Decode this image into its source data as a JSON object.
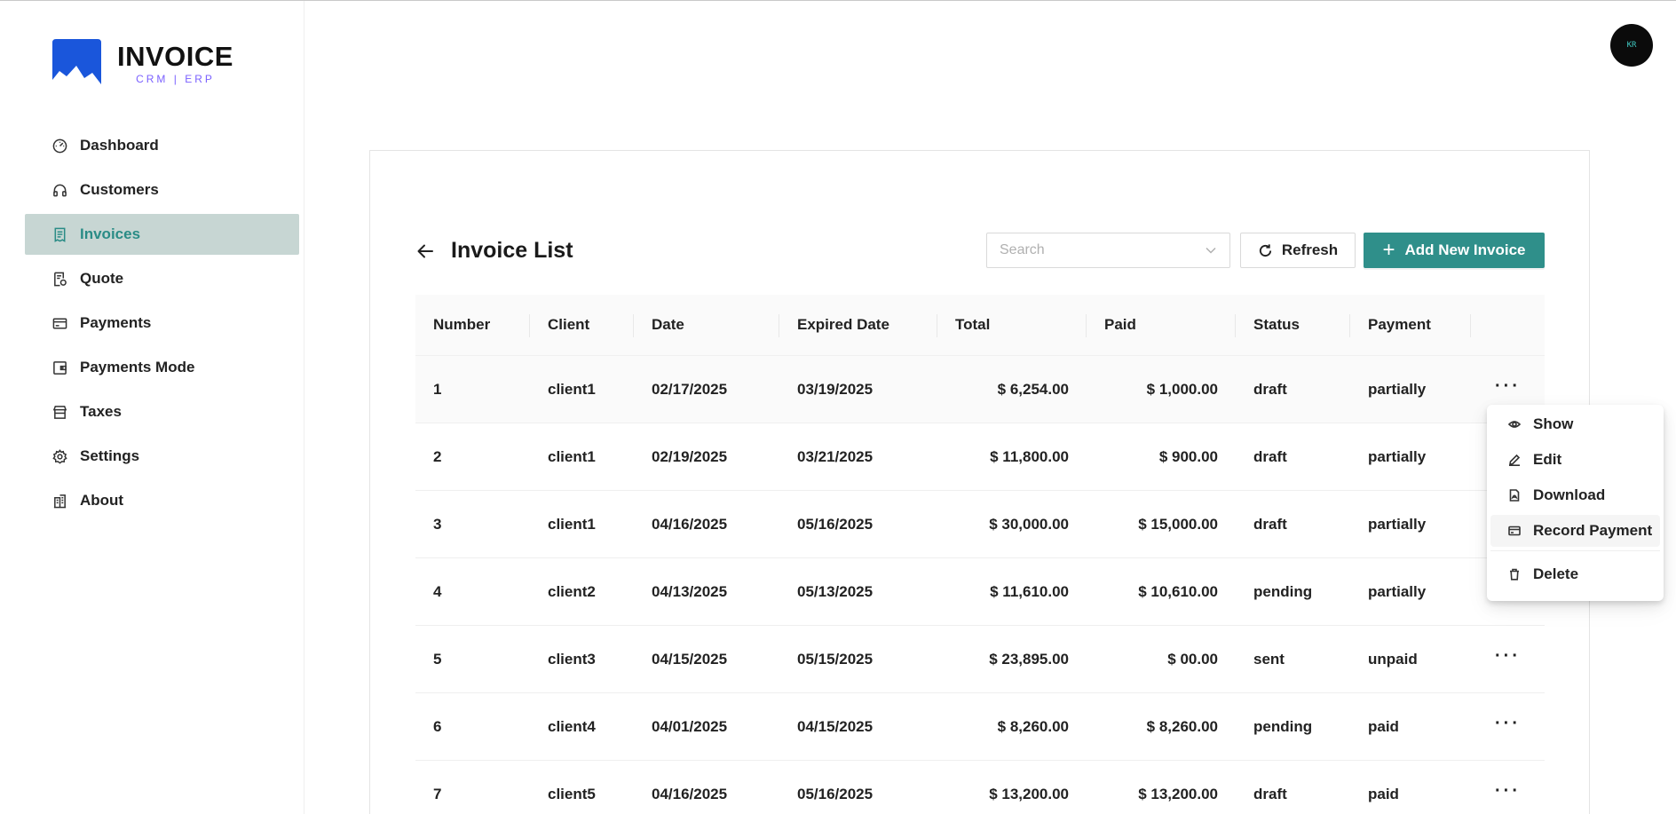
{
  "app": {
    "logo_title": "INVOICE",
    "logo_subtitle": "CRM | ERP",
    "avatar_initials": "KR"
  },
  "sidebar": {
    "items": [
      {
        "label": "Dashboard",
        "icon": "dashboard-icon"
      },
      {
        "label": "Customers",
        "icon": "headset-icon"
      },
      {
        "label": "Invoices",
        "icon": "invoice-icon",
        "active": true
      },
      {
        "label": "Quote",
        "icon": "quote-icon"
      },
      {
        "label": "Payments",
        "icon": "credit-card-icon"
      },
      {
        "label": "Payments Mode",
        "icon": "wallet-icon"
      },
      {
        "label": "Taxes",
        "icon": "shop-icon"
      },
      {
        "label": "Settings",
        "icon": "gear-icon"
      },
      {
        "label": "About",
        "icon": "building-icon"
      }
    ]
  },
  "header": {
    "title": "Invoice List",
    "search_placeholder": "Search",
    "refresh_label": "Refresh",
    "add_label": "Add New Invoice"
  },
  "table": {
    "columns": [
      "Number",
      "Client",
      "Date",
      "Expired Date",
      "Total",
      "Paid",
      "Status",
      "Payment"
    ],
    "rows": [
      {
        "number": "1",
        "client": "client1",
        "date": "02/17/2025",
        "expired": "03/19/2025",
        "total": "$ 6,254.00",
        "paid": "$ 1,000.00",
        "status": "draft",
        "payment": "partially"
      },
      {
        "number": "2",
        "client": "client1",
        "date": "02/19/2025",
        "expired": "03/21/2025",
        "total": "$ 11,800.00",
        "paid": "$ 900.00",
        "status": "draft",
        "payment": "partially"
      },
      {
        "number": "3",
        "client": "client1",
        "date": "04/16/2025",
        "expired": "05/16/2025",
        "total": "$ 30,000.00",
        "paid": "$ 15,000.00",
        "status": "draft",
        "payment": "partially"
      },
      {
        "number": "4",
        "client": "client2",
        "date": "04/13/2025",
        "expired": "05/13/2025",
        "total": "$ 11,610.00",
        "paid": "$ 10,610.00",
        "status": "pending",
        "payment": "partially"
      },
      {
        "number": "5",
        "client": "client3",
        "date": "04/15/2025",
        "expired": "05/15/2025",
        "total": "$ 23,895.00",
        "paid": "$ 00.00",
        "status": "sent",
        "payment": "unpaid"
      },
      {
        "number": "6",
        "client": "client4",
        "date": "04/01/2025",
        "expired": "04/15/2025",
        "total": "$ 8,260.00",
        "paid": "$ 8,260.00",
        "status": "pending",
        "payment": "paid"
      },
      {
        "number": "7",
        "client": "client5",
        "date": "04/16/2025",
        "expired": "05/16/2025",
        "total": "$ 13,200.00",
        "paid": "$ 13,200.00",
        "status": "draft",
        "payment": "paid"
      }
    ],
    "actions_glyph": "···"
  },
  "menu": {
    "items": [
      {
        "label": "Show",
        "icon": "eye-icon"
      },
      {
        "label": "Edit",
        "icon": "pencil-icon"
      },
      {
        "label": "Download",
        "icon": "file-pdf-icon"
      },
      {
        "label": "Record Payment",
        "icon": "credit-card-icon"
      },
      {
        "label": "Delete",
        "icon": "trash-icon"
      }
    ]
  },
  "colors": {
    "accent": "#2f8f8a",
    "sidebar_active_bg": "#c7d6d3",
    "logo_blue": "#1a56db",
    "logo_sub": "#7b61ff"
  }
}
